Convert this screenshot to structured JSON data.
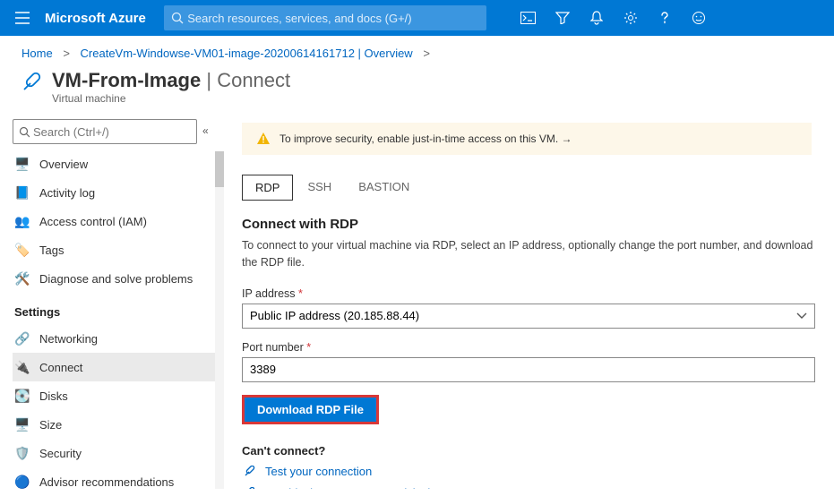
{
  "header": {
    "brand": "Microsoft Azure",
    "search_placeholder": "Search resources, services, and docs (G+/)"
  },
  "breadcrumbs": {
    "home": "Home",
    "item1": "CreateVm-Windowse-VM01-image-20200614161712 | Overview"
  },
  "page": {
    "title_main": "VM-From-Image",
    "title_sep": " | ",
    "title_sub": "Connect",
    "subtitle": "Virtual machine"
  },
  "sidebar": {
    "search_placeholder": "Search (Ctrl+/)",
    "items_top": [
      {
        "label": "Overview"
      },
      {
        "label": "Activity log"
      },
      {
        "label": "Access control (IAM)"
      },
      {
        "label": "Tags"
      },
      {
        "label": "Diagnose and solve problems"
      }
    ],
    "section_settings": "Settings",
    "items_settings": [
      {
        "label": "Networking"
      },
      {
        "label": "Connect"
      },
      {
        "label": "Disks"
      },
      {
        "label": "Size"
      },
      {
        "label": "Security"
      },
      {
        "label": "Advisor recommendations"
      }
    ]
  },
  "banner": {
    "text": "To improve security, enable just-in-time access on this VM.  →"
  },
  "tabs": {
    "rdp": "RDP",
    "ssh": "SSH",
    "bastion": "BASTION"
  },
  "connect": {
    "title": "Connect with RDP",
    "desc": "To connect to your virtual machine via RDP, select an IP address, optionally change the port number, and download the RDP file.",
    "ip_label": "IP address",
    "ip_value": "Public IP address (20.185.88.44)",
    "port_label": "Port number",
    "port_value": "3389",
    "download_btn": "Download RDP File"
  },
  "help": {
    "title": "Can't connect?",
    "link1": "Test your connection",
    "link2": "Troubleshoot RDP connectivity issues"
  }
}
